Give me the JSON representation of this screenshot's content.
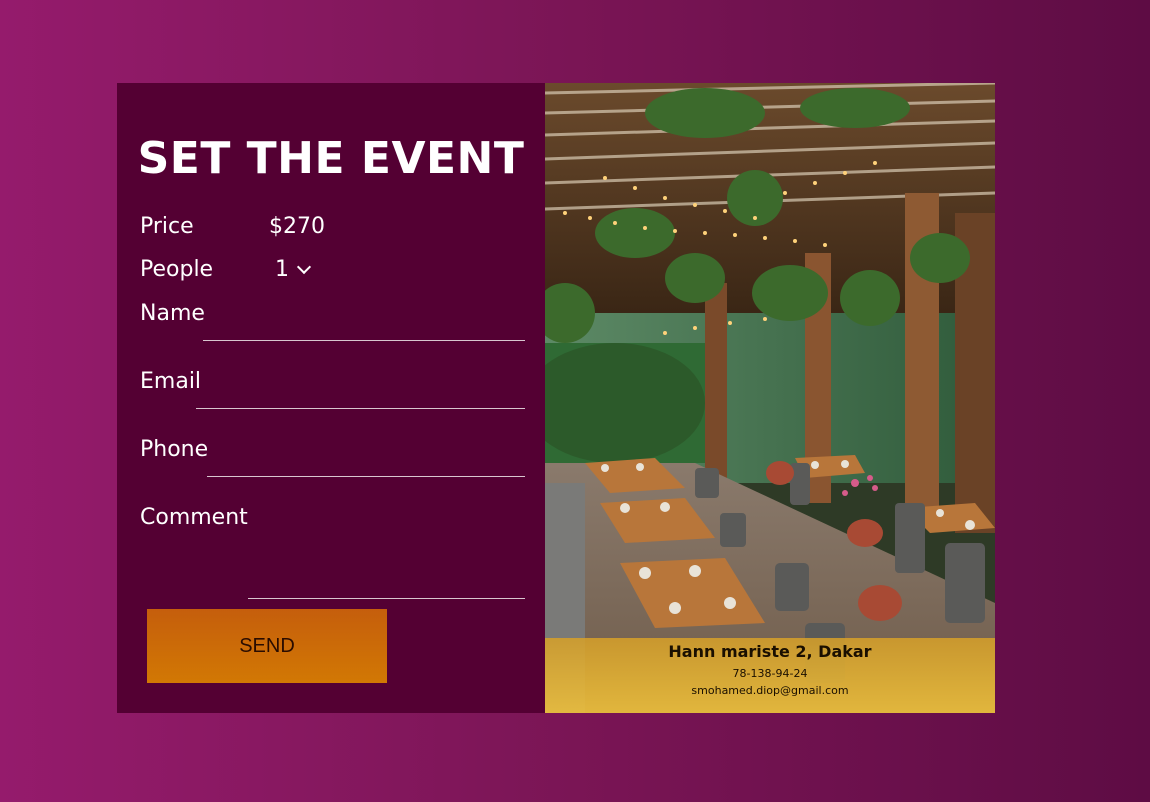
{
  "form": {
    "title": "SET THE EVENT",
    "price_label": "Price",
    "price_value": "$270",
    "people_label": "People",
    "people_selected": "1",
    "name_label": "Name",
    "email_label": "Email",
    "phone_label": "Phone",
    "comment_label": "Comment",
    "name_value": "",
    "email_value": "",
    "phone_value": "",
    "comment_value": "",
    "send_label": "SEND"
  },
  "info": {
    "address": "Hann mariste 2, Dakar",
    "phone": "78-138-94-24",
    "email": "smohamed.diop@gmail.com"
  },
  "colors": {
    "background_left": "#951b6c",
    "background_right": "#5e0c44",
    "form_panel": "#540033",
    "send_button": "#c8640a",
    "info_bar": "#e0b040"
  }
}
